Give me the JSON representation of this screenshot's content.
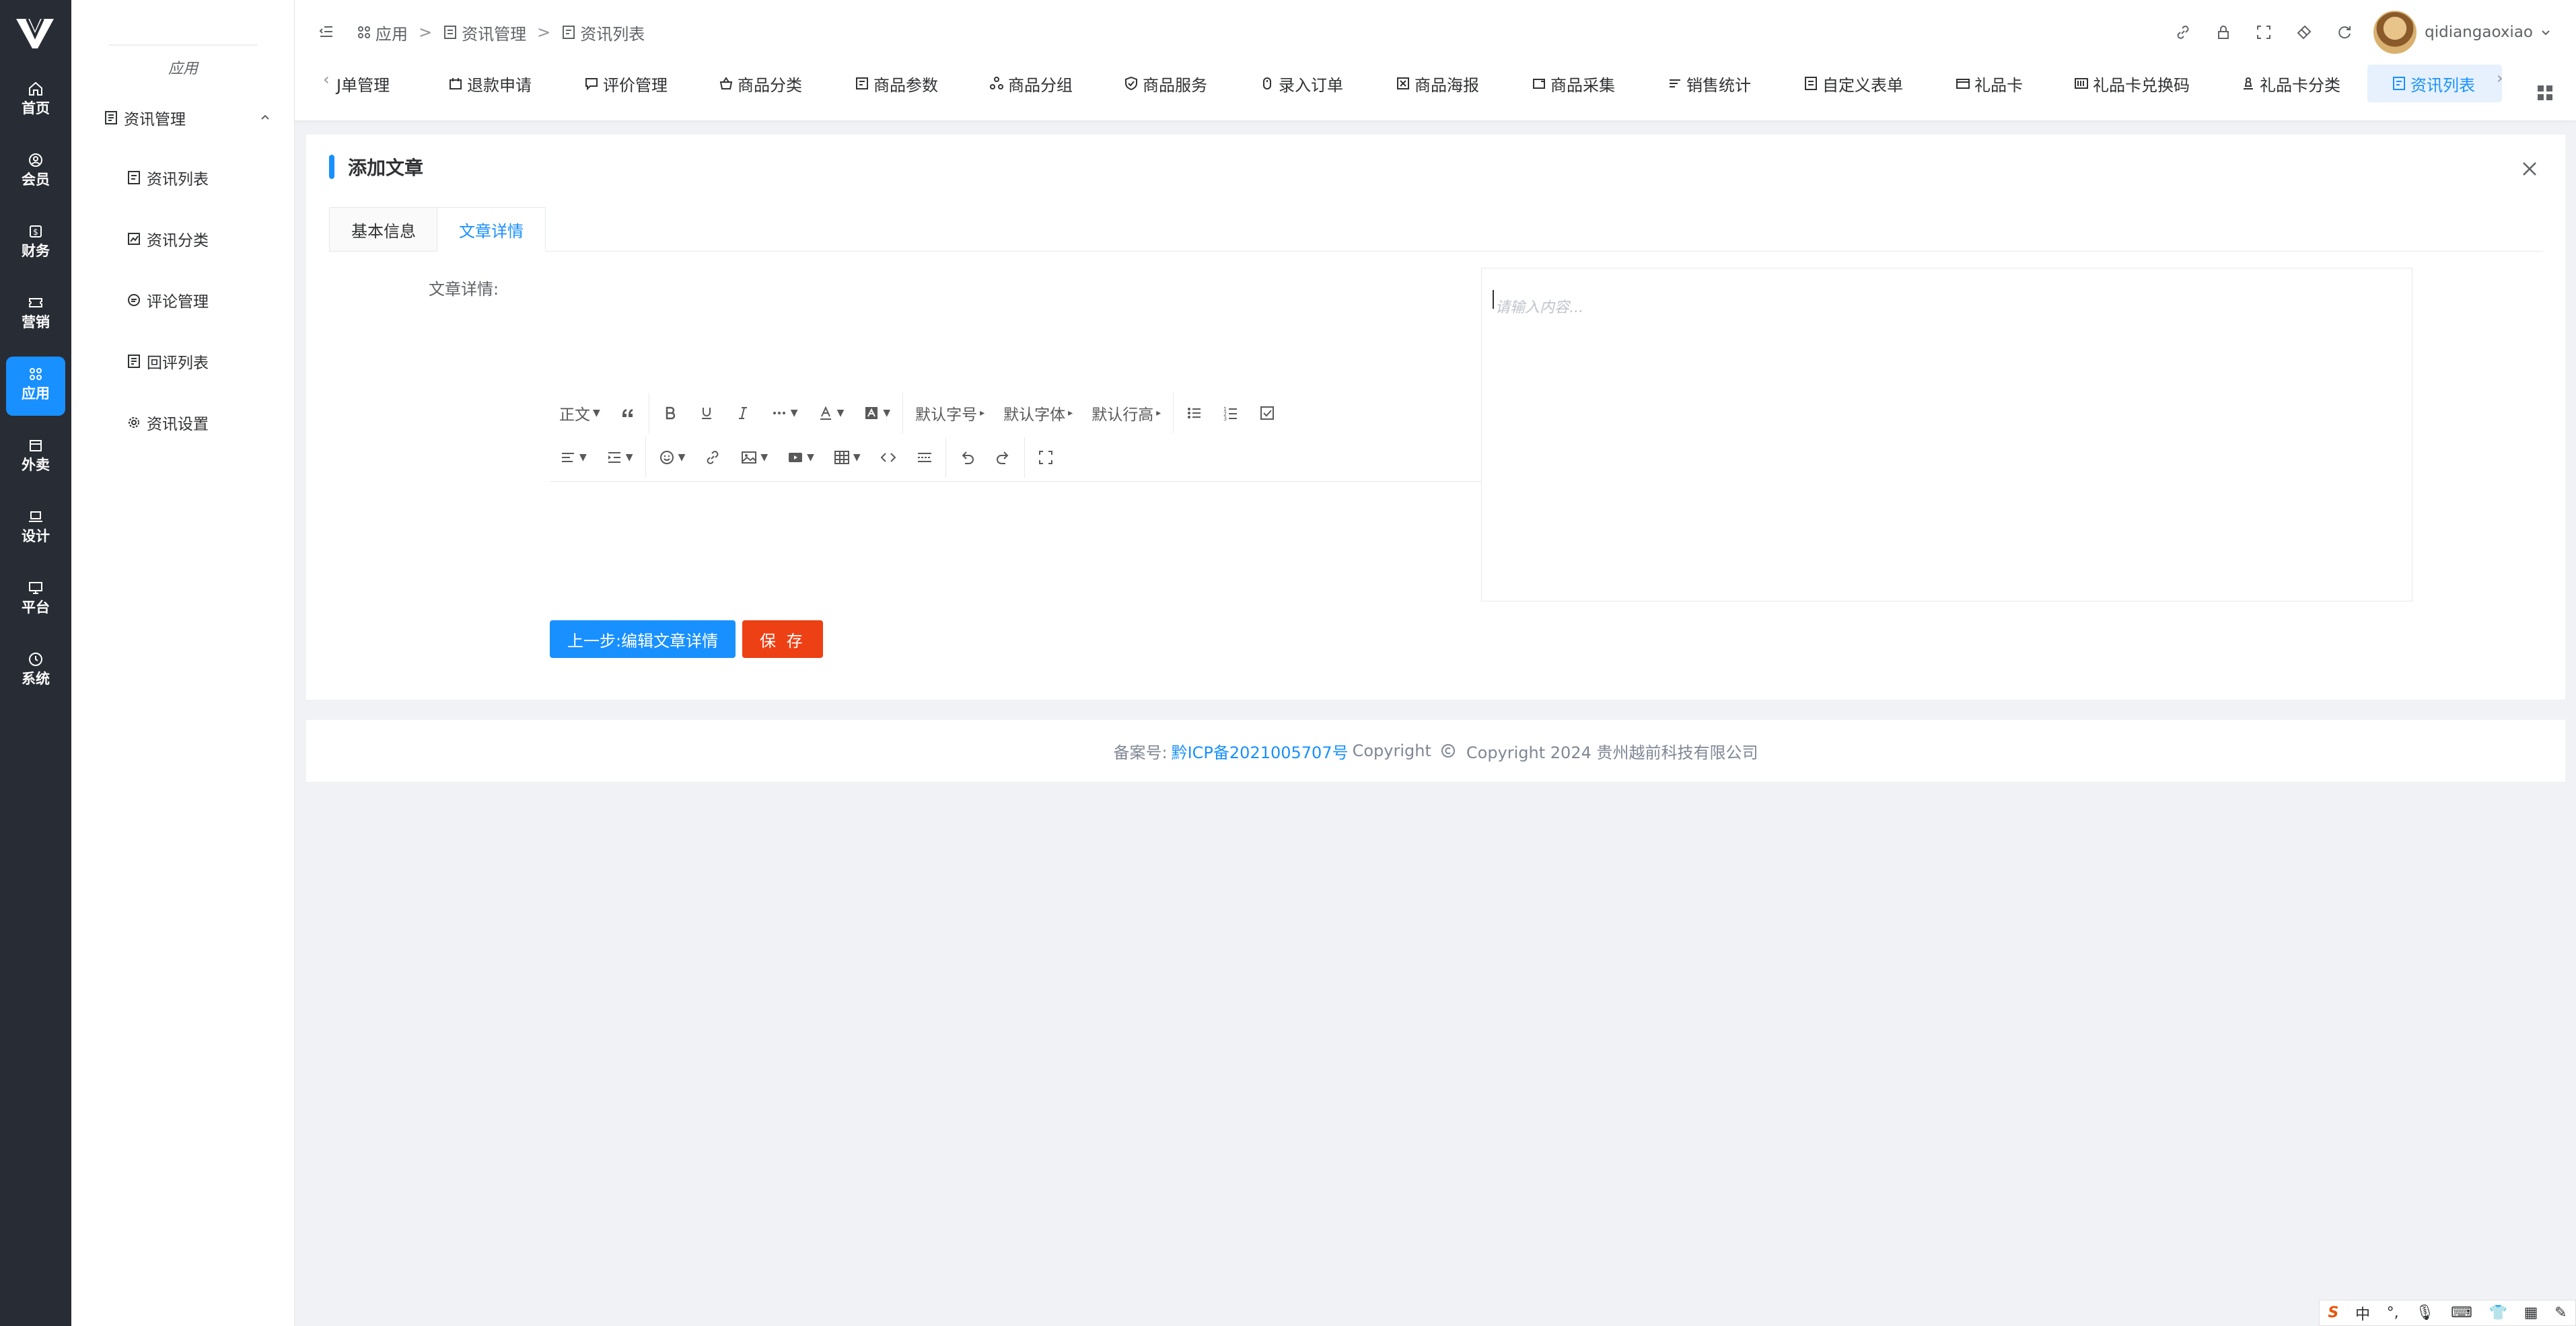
{
  "rail": {
    "items": [
      {
        "label": "首页",
        "icon": "home-icon"
      },
      {
        "label": "会员",
        "icon": "user-circle-icon"
      },
      {
        "label": "财务",
        "icon": "money-icon"
      },
      {
        "label": "营销",
        "icon": "ticket-icon"
      },
      {
        "label": "应用",
        "icon": "apps-icon",
        "active": true
      },
      {
        "label": "外卖",
        "icon": "store-icon"
      },
      {
        "label": "设计",
        "icon": "laptop-icon"
      },
      {
        "label": "平台",
        "icon": "monitor-icon"
      },
      {
        "label": "系统",
        "icon": "clock-icon"
      }
    ]
  },
  "sidebar": {
    "title": "应用",
    "group": {
      "label": "资讯管理",
      "icon": "news-icon"
    },
    "items": [
      {
        "label": "资讯列表",
        "icon": "list-doc-icon"
      },
      {
        "label": "资讯分类",
        "icon": "chart-icon"
      },
      {
        "label": "评论管理",
        "icon": "comment-icon"
      },
      {
        "label": "回评列表",
        "icon": "reply-doc-icon"
      },
      {
        "label": "资讯设置",
        "icon": "gear-icon"
      }
    ]
  },
  "header": {
    "breadcrumb": [
      {
        "label": "应用",
        "icon": "apps-icon"
      },
      {
        "label": "资讯管理",
        "icon": "news-icon"
      },
      {
        "label": "资讯列表",
        "icon": "list-doc-icon"
      }
    ],
    "separator": ">",
    "username": "qidiangaoxiao"
  },
  "tabs": {
    "prev": "‹",
    "next": "›",
    "items": [
      {
        "label": "丁单管理",
        "display": "J单管理"
      },
      {
        "label": "退款申请"
      },
      {
        "label": "评价管理"
      },
      {
        "label": "商品分类"
      },
      {
        "label": "商品参数"
      },
      {
        "label": "商品分组"
      },
      {
        "label": "商品服务"
      },
      {
        "label": "录入订单"
      },
      {
        "label": "商品海报"
      },
      {
        "label": "商品采集"
      },
      {
        "label": "销售统计"
      },
      {
        "label": "自定义表单"
      },
      {
        "label": "礼品卡"
      },
      {
        "label": "礼品卡兑换码"
      },
      {
        "label": "礼品卡分类"
      },
      {
        "label": "资讯列表",
        "active": true
      }
    ]
  },
  "card": {
    "title": "添加文章",
    "tabs": [
      {
        "label": "基本信息"
      },
      {
        "label": "文章详情",
        "active": true
      }
    ],
    "field_label": "文章详情:",
    "editor": {
      "placeholder": "请输入内容...",
      "toolbar": {
        "paragraph": "正文",
        "font_size": "默认字号",
        "font_family": "默认字体",
        "line_height": "默认行高"
      }
    },
    "buttons": {
      "prev": "上一步:编辑文章详情",
      "save": "保 存"
    }
  },
  "footer": {
    "prefix": "备案号:",
    "icp": "黔ICP备2021005707号",
    "copyright_word": "Copyright",
    "copyright_text": "Copyright 2024 贵州越前科技有限公司"
  },
  "ime": {
    "lang": "中",
    "punct": "°,"
  },
  "colors": {
    "primary": "#1890ff",
    "danger": "#ed4014",
    "rail_bg": "#282c34"
  }
}
